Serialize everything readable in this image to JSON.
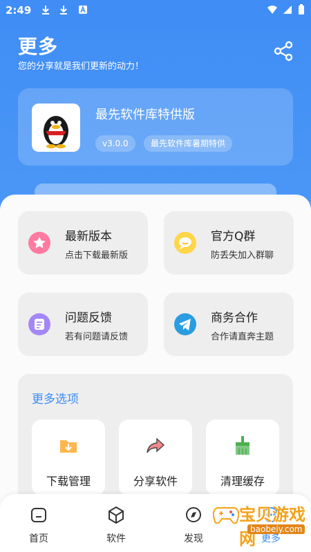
{
  "status_bar": {
    "time": "2:49"
  },
  "header": {
    "title": "更多",
    "subtitle": "您的分享就是我们更新的动力！"
  },
  "app": {
    "name": "最先软件库特供版",
    "version": "v3.0.0",
    "tag": "最先软件库暑期特供"
  },
  "tiles": [
    {
      "title": "最新版本",
      "subtitle": "点击下载最新版",
      "icon": "star-icon",
      "color": "#ff6f91"
    },
    {
      "title": "官方Q群",
      "subtitle": "防丢失加入群聊",
      "icon": "chat-bubble-icon",
      "color": "#ffcf3d"
    },
    {
      "title": "问题反馈",
      "subtitle": "若有问题请反馈",
      "icon": "feedback-icon",
      "color": "#9a7cf4"
    },
    {
      "title": "商务合作",
      "subtitle": "合作请直奔主题",
      "icon": "telegram-icon",
      "color": "#2a9de0"
    }
  ],
  "more_options": {
    "title": "更多选项",
    "items": [
      {
        "label": "下载管理",
        "icon": "download-folder-icon"
      },
      {
        "label": "分享软件",
        "icon": "share-arrow-icon"
      },
      {
        "label": "清理缓存",
        "icon": "broom-icon"
      }
    ]
  },
  "bottom_nav": [
    {
      "label": "首页",
      "icon": "home-icon",
      "active": false
    },
    {
      "label": "软件",
      "icon": "box-icon",
      "active": false
    },
    {
      "label": "发现",
      "icon": "compass-icon",
      "active": false
    },
    {
      "label": "更多",
      "icon": "more-icon",
      "active": true
    }
  ],
  "watermark": {
    "text": "宝贝游戏网",
    "url": "baobeiy.com"
  },
  "colors": {
    "primary": "#3f8df5",
    "accent_text": "#3a8df5"
  }
}
